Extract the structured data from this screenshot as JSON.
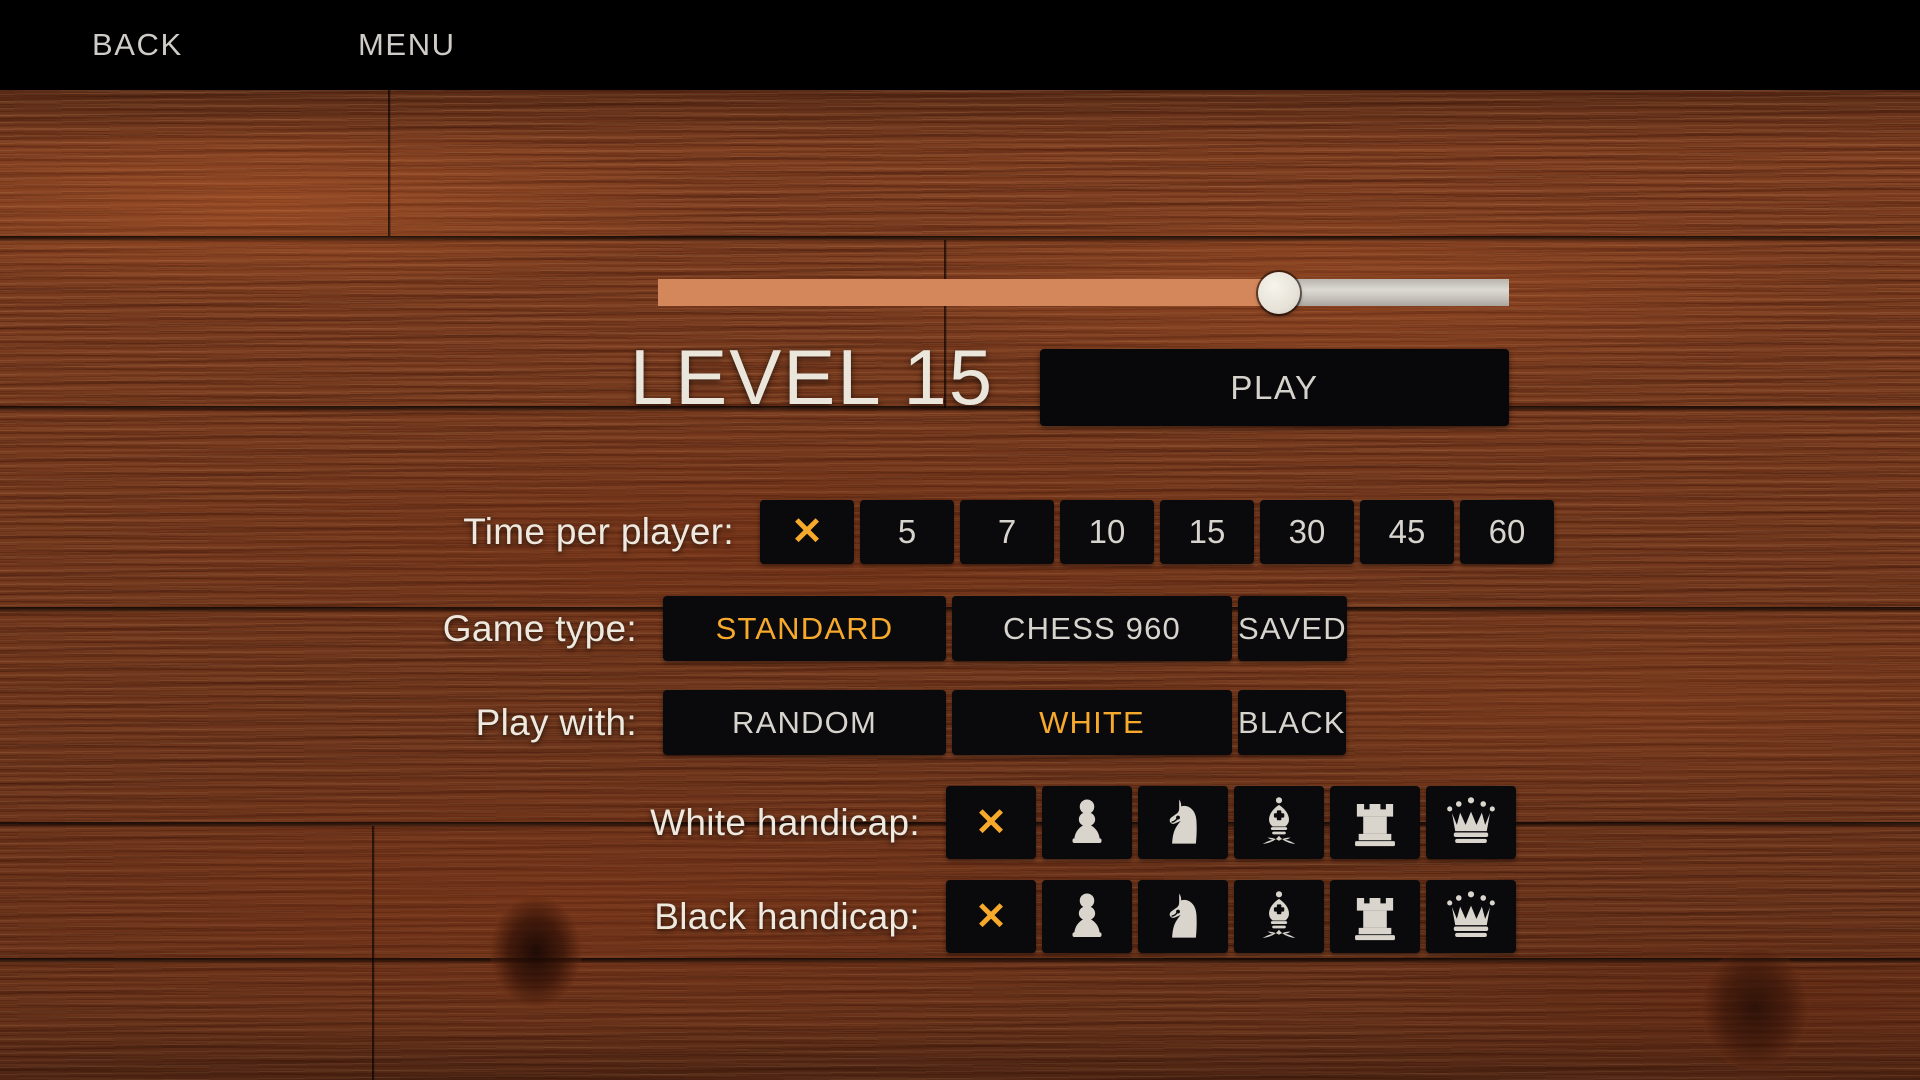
{
  "topbar": {
    "back_label": "BACK",
    "menu_label": "MENU"
  },
  "slider": {
    "level_value": 15,
    "min": 1,
    "max": 20,
    "fill_percent": 73,
    "fill_color": "#d4875a",
    "track_color": "#ccc7c1",
    "thumb_color": "#eeeae0"
  },
  "header": {
    "level_label": "LEVEL 15",
    "play_label": "PLAY"
  },
  "options": {
    "time": {
      "label": "Time per player:",
      "selected_index": 0,
      "items": [
        {
          "label": "✕",
          "kind": "none"
        },
        {
          "label": "5",
          "kind": "minutes"
        },
        {
          "label": "7",
          "kind": "minutes"
        },
        {
          "label": "10",
          "kind": "minutes"
        },
        {
          "label": "15",
          "kind": "minutes"
        },
        {
          "label": "30",
          "kind": "minutes"
        },
        {
          "label": "45",
          "kind": "minutes"
        },
        {
          "label": "60",
          "kind": "minutes"
        }
      ]
    },
    "game_type": {
      "label": "Game type:",
      "selected_index": 0,
      "items": [
        {
          "label": "STANDARD"
        },
        {
          "label": "CHESS 960"
        },
        {
          "label": "SAVED"
        }
      ]
    },
    "play_with": {
      "label": "Play with:",
      "selected_index": 1,
      "items": [
        {
          "label": "RANDOM"
        },
        {
          "label": "WHITE"
        },
        {
          "label": "BLACK"
        }
      ]
    },
    "white_handicap": {
      "label": "White handicap:",
      "selected_index": 0,
      "items": [
        {
          "icon": "none-x-icon"
        },
        {
          "icon": "pawn-icon"
        },
        {
          "icon": "knight-icon"
        },
        {
          "icon": "bishop-icon"
        },
        {
          "icon": "rook-icon"
        },
        {
          "icon": "queen-icon"
        }
      ]
    },
    "black_handicap": {
      "label": "Black handicap:",
      "selected_index": 0,
      "items": [
        {
          "icon": "none-x-icon"
        },
        {
          "icon": "pawn-icon"
        },
        {
          "icon": "knight-icon"
        },
        {
          "icon": "bishop-icon"
        },
        {
          "icon": "rook-icon"
        },
        {
          "icon": "queen-icon"
        }
      ]
    }
  },
  "colors": {
    "accent": "#f7a92c",
    "button_bg": "#0a090c",
    "text": "#d7d3cd",
    "wood": "#8a4423"
  }
}
